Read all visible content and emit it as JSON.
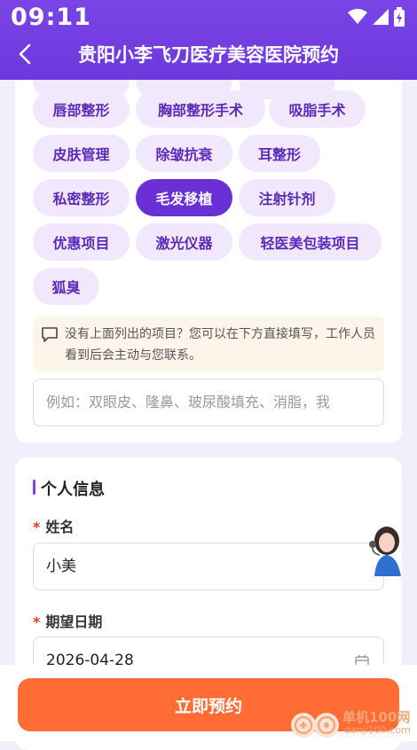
{
  "status": {
    "time": "09:11"
  },
  "header": {
    "title": "贵阳小李飞刀医疗美容医院预约"
  },
  "projects": {
    "chips": [
      {
        "label": "唇部整形",
        "active": false
      },
      {
        "label": "胸部整形手术",
        "active": false
      },
      {
        "label": "吸脂手术",
        "active": false
      },
      {
        "label": "皮肤管理",
        "active": false
      },
      {
        "label": "除皱抗衰",
        "active": false
      },
      {
        "label": "耳整形",
        "active": false
      },
      {
        "label": "私密整形",
        "active": false
      },
      {
        "label": "毛发移植",
        "active": true
      },
      {
        "label": "注射针剂",
        "active": false
      },
      {
        "label": "优惠项目",
        "active": false
      },
      {
        "label": "激光仪器",
        "active": false
      },
      {
        "label": "轻医美包装项目",
        "active": false
      },
      {
        "label": "狐臭",
        "active": false
      }
    ],
    "hint": "没有上面列出的项目？您可以在下方直接填写，工作人员看到后会主动与您联系。",
    "free_input_placeholder": "例如：双眼皮、隆鼻、玻尿酸填充、消脂，我"
  },
  "personal": {
    "section_title": "个人信息",
    "name_label": "姓名",
    "name_value": "小美",
    "date_label": "期望日期",
    "date_value": "2026-04-28"
  },
  "footer": {
    "submit_label": "立即预约"
  },
  "watermark": {
    "text": "单机100网",
    "sub": "danji100.com"
  },
  "colors": {
    "primary": "#6d38dc",
    "accent": "#ff6d35",
    "chip_bg": "#f1e8fd"
  }
}
